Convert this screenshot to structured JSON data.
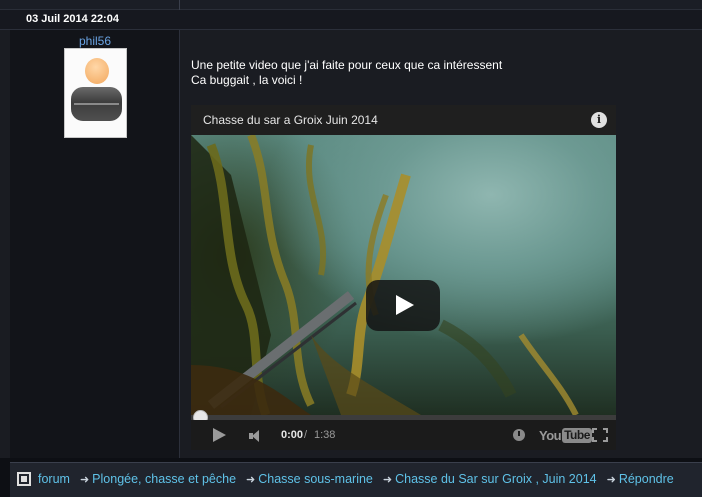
{
  "post": {
    "date": "03 Juil 2014 22:04",
    "author": "phil56",
    "message_line1": "Une petite video que j'ai faite pour ceux que ca intéressent",
    "message_line2": "Ca buggait , la voici !"
  },
  "video": {
    "title": "Chasse du sar a Groix Juin 2014",
    "info_glyph": "i",
    "time_current": "0:00",
    "time_separator": "/",
    "time_total": "1:38",
    "progress": 0,
    "logo_you": "You",
    "logo_tube": "Tube"
  },
  "breadcrumb": {
    "items": [
      "forum",
      "Plongée, chasse et pêche",
      "Chasse sous-marine",
      "Chasse du Sar sur Groix , Juin 2014",
      "Répondre"
    ],
    "arrow": "➜"
  },
  "colors": {
    "link": "#5fc2e8",
    "author": "#6aa3e2",
    "background": "#0d0f14"
  }
}
